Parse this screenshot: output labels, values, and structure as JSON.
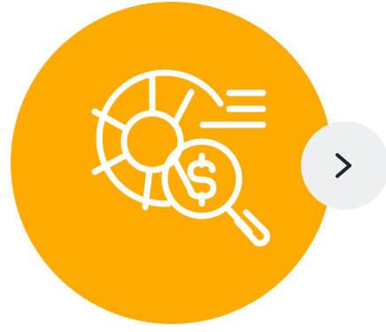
{
  "colors": {
    "hero_background": "#fdab01",
    "icon_stroke": "#ffffff",
    "nav_button_background": "#eeeff0",
    "nav_chevron": "#1d2733"
  },
  "hero": {
    "icon": "financial-analysis-icon",
    "parts": [
      "pie-chart-icon",
      "magnifying-glass-icon",
      "dollar-sign-icon",
      "speed-lines-icon"
    ]
  },
  "navigation": {
    "next_icon": "chevron-right-icon"
  }
}
